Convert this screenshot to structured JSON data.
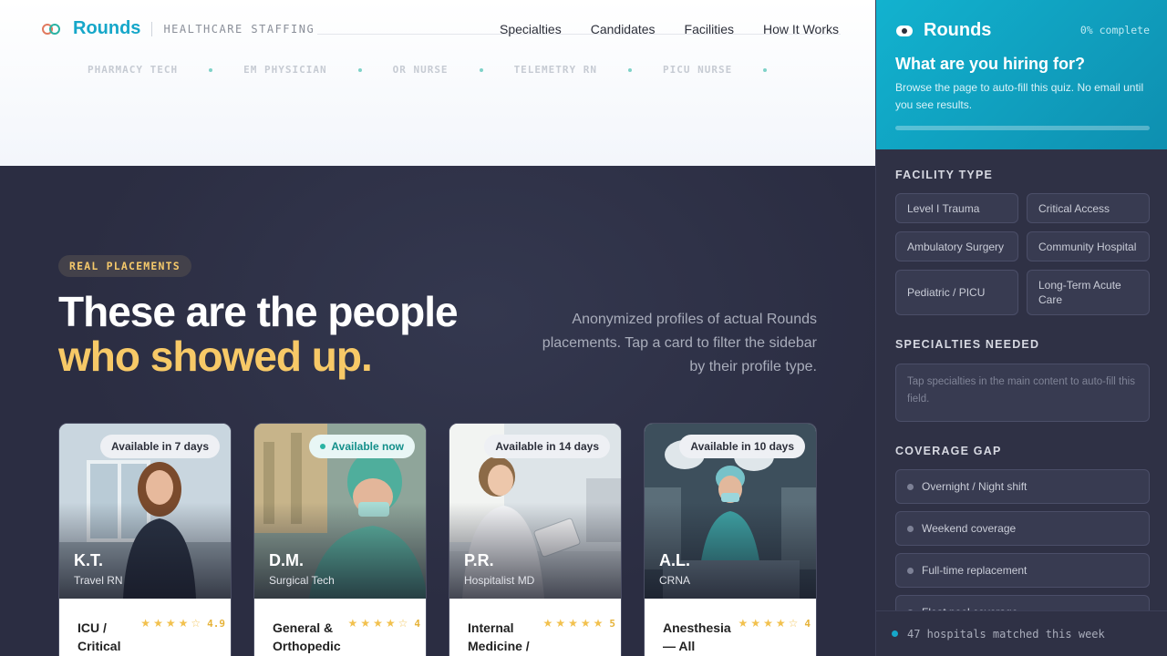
{
  "header": {
    "brand": "Rounds",
    "tagline": "HEALTHCARE STAFFING",
    "nav": [
      "Specialties",
      "Candidates",
      "Facilities",
      "How It Works"
    ],
    "ticker": [
      "PHARMACY TECH",
      "EM PHYSICIAN",
      "OR NURSE",
      "TELEMETRY RN",
      "PICU NURSE"
    ]
  },
  "hero": {
    "pill": "REAL PLACEMENTS",
    "headline_line1": "These are the people",
    "headline_line2": "who showed up.",
    "lede": "Anonymized profiles of actual Rounds placements. Tap a card to filter the sidebar by their profile type."
  },
  "cards": [
    {
      "badge": "Available in 7 days",
      "initials": "K.T.",
      "role": "Travel RN",
      "specialty": "ICU / Critical",
      "stars": 4,
      "score": "4.9",
      "badge_now": false
    },
    {
      "badge": "Available now",
      "initials": "D.M.",
      "role": "Surgical Tech",
      "specialty": "General & Orthopedic",
      "stars": 4,
      "score": "4",
      "badge_now": true
    },
    {
      "badge": "Available in 14 days",
      "initials": "P.R.",
      "role": "Hospitalist MD",
      "specialty": "Internal Medicine /",
      "stars": 5,
      "score": "5",
      "badge_now": false
    },
    {
      "badge": "Available in 10 days",
      "initials": "A.L.",
      "role": "CRNA",
      "specialty": "Anesthesia — All",
      "stars": 4,
      "score": "4",
      "badge_now": false
    }
  ],
  "sidebar": {
    "brand": "Rounds",
    "progress_label": "0% complete",
    "progress": 0,
    "title": "What are you hiring for?",
    "subtitle": "Browse the page to auto-fill this quiz. No email until you see results.",
    "facility_label": "FACILITY TYPE",
    "facility_types": [
      "Level I Trauma",
      "Critical Access",
      "Ambulatory Surgery",
      "Community Hospital",
      "Pediatric / PICU",
      "Long-Term Acute Care"
    ],
    "specialties_label": "SPECIALTIES NEEDED",
    "specialties_placeholder": "Tap specialties in the main content to auto-fill this field.",
    "coverage_label": "COVERAGE GAP",
    "coverage_options": [
      "Overnight / Night shift",
      "Weekend coverage",
      "Full-time replacement",
      "Float pool coverage"
    ],
    "footer": "47 hospitals matched this week"
  }
}
